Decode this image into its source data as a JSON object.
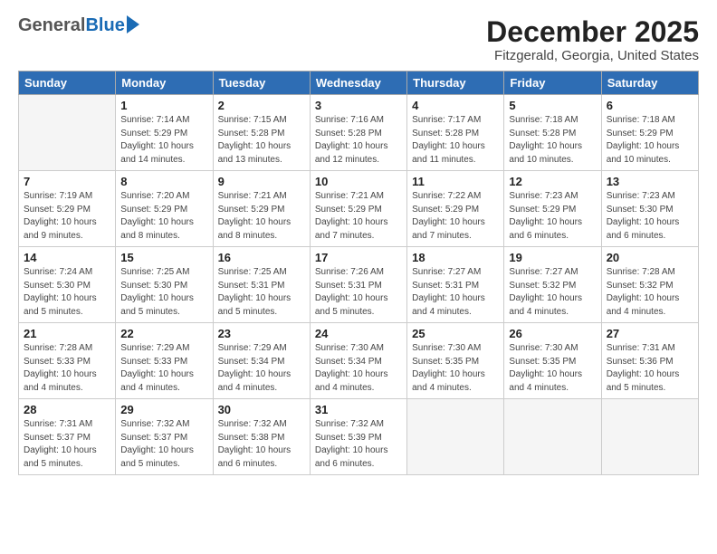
{
  "logo": {
    "general": "General",
    "blue": "Blue"
  },
  "title": "December 2025",
  "location": "Fitzgerald, Georgia, United States",
  "days_of_week": [
    "Sunday",
    "Monday",
    "Tuesday",
    "Wednesday",
    "Thursday",
    "Friday",
    "Saturday"
  ],
  "weeks": [
    [
      {
        "day": "",
        "info": ""
      },
      {
        "day": "1",
        "info": "Sunrise: 7:14 AM\nSunset: 5:29 PM\nDaylight: 10 hours\nand 14 minutes."
      },
      {
        "day": "2",
        "info": "Sunrise: 7:15 AM\nSunset: 5:28 PM\nDaylight: 10 hours\nand 13 minutes."
      },
      {
        "day": "3",
        "info": "Sunrise: 7:16 AM\nSunset: 5:28 PM\nDaylight: 10 hours\nand 12 minutes."
      },
      {
        "day": "4",
        "info": "Sunrise: 7:17 AM\nSunset: 5:28 PM\nDaylight: 10 hours\nand 11 minutes."
      },
      {
        "day": "5",
        "info": "Sunrise: 7:18 AM\nSunset: 5:28 PM\nDaylight: 10 hours\nand 10 minutes."
      },
      {
        "day": "6",
        "info": "Sunrise: 7:18 AM\nSunset: 5:29 PM\nDaylight: 10 hours\nand 10 minutes."
      }
    ],
    [
      {
        "day": "7",
        "info": "Sunrise: 7:19 AM\nSunset: 5:29 PM\nDaylight: 10 hours\nand 9 minutes."
      },
      {
        "day": "8",
        "info": "Sunrise: 7:20 AM\nSunset: 5:29 PM\nDaylight: 10 hours\nand 8 minutes."
      },
      {
        "day": "9",
        "info": "Sunrise: 7:21 AM\nSunset: 5:29 PM\nDaylight: 10 hours\nand 8 minutes."
      },
      {
        "day": "10",
        "info": "Sunrise: 7:21 AM\nSunset: 5:29 PM\nDaylight: 10 hours\nand 7 minutes."
      },
      {
        "day": "11",
        "info": "Sunrise: 7:22 AM\nSunset: 5:29 PM\nDaylight: 10 hours\nand 7 minutes."
      },
      {
        "day": "12",
        "info": "Sunrise: 7:23 AM\nSunset: 5:29 PM\nDaylight: 10 hours\nand 6 minutes."
      },
      {
        "day": "13",
        "info": "Sunrise: 7:23 AM\nSunset: 5:30 PM\nDaylight: 10 hours\nand 6 minutes."
      }
    ],
    [
      {
        "day": "14",
        "info": "Sunrise: 7:24 AM\nSunset: 5:30 PM\nDaylight: 10 hours\nand 5 minutes."
      },
      {
        "day": "15",
        "info": "Sunrise: 7:25 AM\nSunset: 5:30 PM\nDaylight: 10 hours\nand 5 minutes."
      },
      {
        "day": "16",
        "info": "Sunrise: 7:25 AM\nSunset: 5:31 PM\nDaylight: 10 hours\nand 5 minutes."
      },
      {
        "day": "17",
        "info": "Sunrise: 7:26 AM\nSunset: 5:31 PM\nDaylight: 10 hours\nand 5 minutes."
      },
      {
        "day": "18",
        "info": "Sunrise: 7:27 AM\nSunset: 5:31 PM\nDaylight: 10 hours\nand 4 minutes."
      },
      {
        "day": "19",
        "info": "Sunrise: 7:27 AM\nSunset: 5:32 PM\nDaylight: 10 hours\nand 4 minutes."
      },
      {
        "day": "20",
        "info": "Sunrise: 7:28 AM\nSunset: 5:32 PM\nDaylight: 10 hours\nand 4 minutes."
      }
    ],
    [
      {
        "day": "21",
        "info": "Sunrise: 7:28 AM\nSunset: 5:33 PM\nDaylight: 10 hours\nand 4 minutes."
      },
      {
        "day": "22",
        "info": "Sunrise: 7:29 AM\nSunset: 5:33 PM\nDaylight: 10 hours\nand 4 minutes."
      },
      {
        "day": "23",
        "info": "Sunrise: 7:29 AM\nSunset: 5:34 PM\nDaylight: 10 hours\nand 4 minutes."
      },
      {
        "day": "24",
        "info": "Sunrise: 7:30 AM\nSunset: 5:34 PM\nDaylight: 10 hours\nand 4 minutes."
      },
      {
        "day": "25",
        "info": "Sunrise: 7:30 AM\nSunset: 5:35 PM\nDaylight: 10 hours\nand 4 minutes."
      },
      {
        "day": "26",
        "info": "Sunrise: 7:30 AM\nSunset: 5:35 PM\nDaylight: 10 hours\nand 4 minutes."
      },
      {
        "day": "27",
        "info": "Sunrise: 7:31 AM\nSunset: 5:36 PM\nDaylight: 10 hours\nand 5 minutes."
      }
    ],
    [
      {
        "day": "28",
        "info": "Sunrise: 7:31 AM\nSunset: 5:37 PM\nDaylight: 10 hours\nand 5 minutes."
      },
      {
        "day": "29",
        "info": "Sunrise: 7:32 AM\nSunset: 5:37 PM\nDaylight: 10 hours\nand 5 minutes."
      },
      {
        "day": "30",
        "info": "Sunrise: 7:32 AM\nSunset: 5:38 PM\nDaylight: 10 hours\nand 6 minutes."
      },
      {
        "day": "31",
        "info": "Sunrise: 7:32 AM\nSunset: 5:39 PM\nDaylight: 10 hours\nand 6 minutes."
      },
      {
        "day": "",
        "info": ""
      },
      {
        "day": "",
        "info": ""
      },
      {
        "day": "",
        "info": ""
      }
    ]
  ]
}
